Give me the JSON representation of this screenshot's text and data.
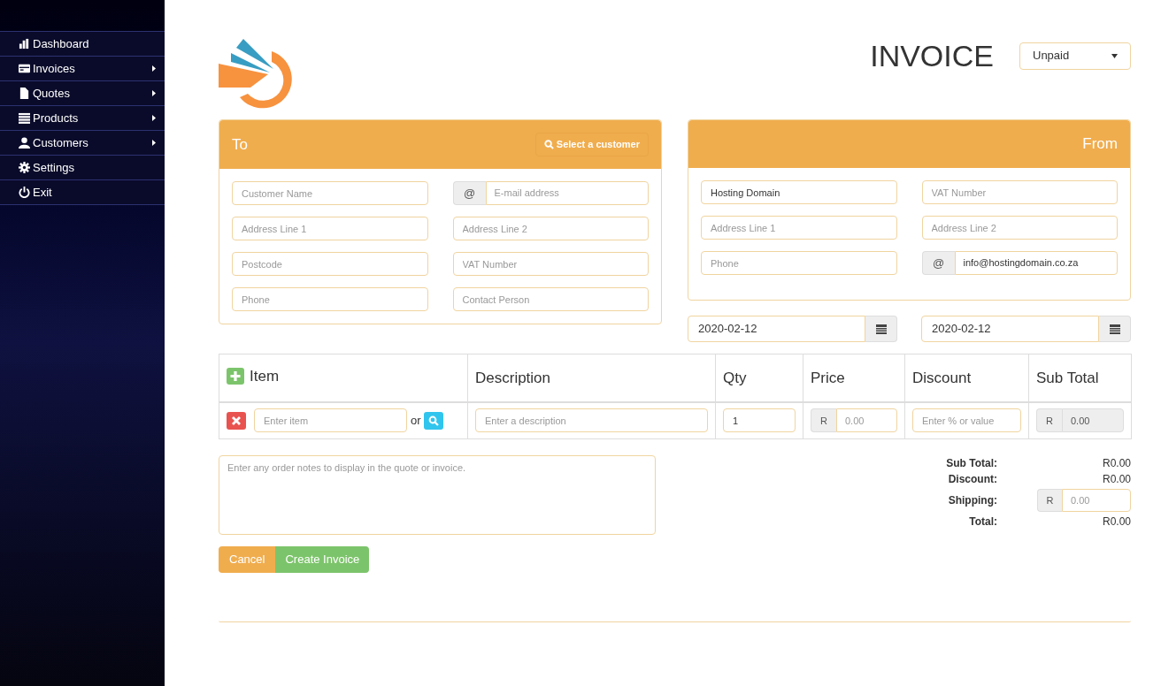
{
  "sidebar": {
    "items": [
      {
        "label": "Dashboard",
        "has_submenu": false
      },
      {
        "label": "Invoices",
        "has_submenu": true
      },
      {
        "label": "Quotes",
        "has_submenu": true
      },
      {
        "label": "Products",
        "has_submenu": true
      },
      {
        "label": "Customers",
        "has_submenu": true
      },
      {
        "label": "Settings",
        "has_submenu": false
      },
      {
        "label": "Exit",
        "has_submenu": false
      }
    ]
  },
  "header": {
    "title": "INVOICE",
    "status_select": {
      "value": "Unpaid"
    }
  },
  "to_panel": {
    "title": "To",
    "select_button": "Select a customer",
    "fields": [
      {
        "kind": "text",
        "placeholder": "Customer Name"
      },
      {
        "kind": "addon",
        "addon": "@",
        "placeholder": "E-mail address"
      },
      {
        "kind": "text",
        "placeholder": "Address Line 1"
      },
      {
        "kind": "text",
        "placeholder": "Address Line 2"
      },
      {
        "kind": "text",
        "placeholder": "Postcode"
      },
      {
        "kind": "text",
        "placeholder": "VAT Number"
      },
      {
        "kind": "text",
        "placeholder": "Phone"
      },
      {
        "kind": "text",
        "placeholder": "Contact Person"
      }
    ]
  },
  "from_panel": {
    "title": "From",
    "fields": [
      {
        "kind": "text",
        "value": "Hosting Domain"
      },
      {
        "kind": "text",
        "placeholder": "VAT Number"
      },
      {
        "kind": "text",
        "placeholder": "Address Line 1"
      },
      {
        "kind": "text",
        "placeholder": "Address Line 2"
      },
      {
        "kind": "text",
        "placeholder": "Phone"
      },
      {
        "kind": "addon",
        "addon": "@",
        "value": "info@hostingdomain.co.za"
      }
    ]
  },
  "dates": [
    {
      "value": "2020-02-12"
    },
    {
      "value": "2020-02-12"
    }
  ],
  "items_table": {
    "columns": [
      "Item",
      "Description",
      "Qty",
      "Price",
      "Discount",
      "Sub Total"
    ],
    "rows": [
      {
        "item_placeholder": "Enter item",
        "or_text": "or",
        "description_placeholder": "Enter a description",
        "qty": "1",
        "price_prefix": "R",
        "price_placeholder": "0.00",
        "discount_placeholder": "Enter % or value",
        "subtotal_prefix": "R",
        "subtotal_value": "0.00"
      }
    ]
  },
  "notes": {
    "placeholder": "Enter any order notes to display in the quote or invoice."
  },
  "totals": [
    {
      "kind": "text",
      "label": "Sub Total:",
      "value": "R0.00"
    },
    {
      "kind": "text",
      "label": "Discount:",
      "value": "R0.00"
    },
    {
      "kind": "input",
      "label": "Shipping:",
      "prefix": "R",
      "placeholder": "0.00"
    },
    {
      "kind": "text",
      "label": "Total:",
      "value": "R0.00"
    }
  ],
  "buttons": {
    "cancel": "Cancel",
    "create": "Create Invoice"
  }
}
